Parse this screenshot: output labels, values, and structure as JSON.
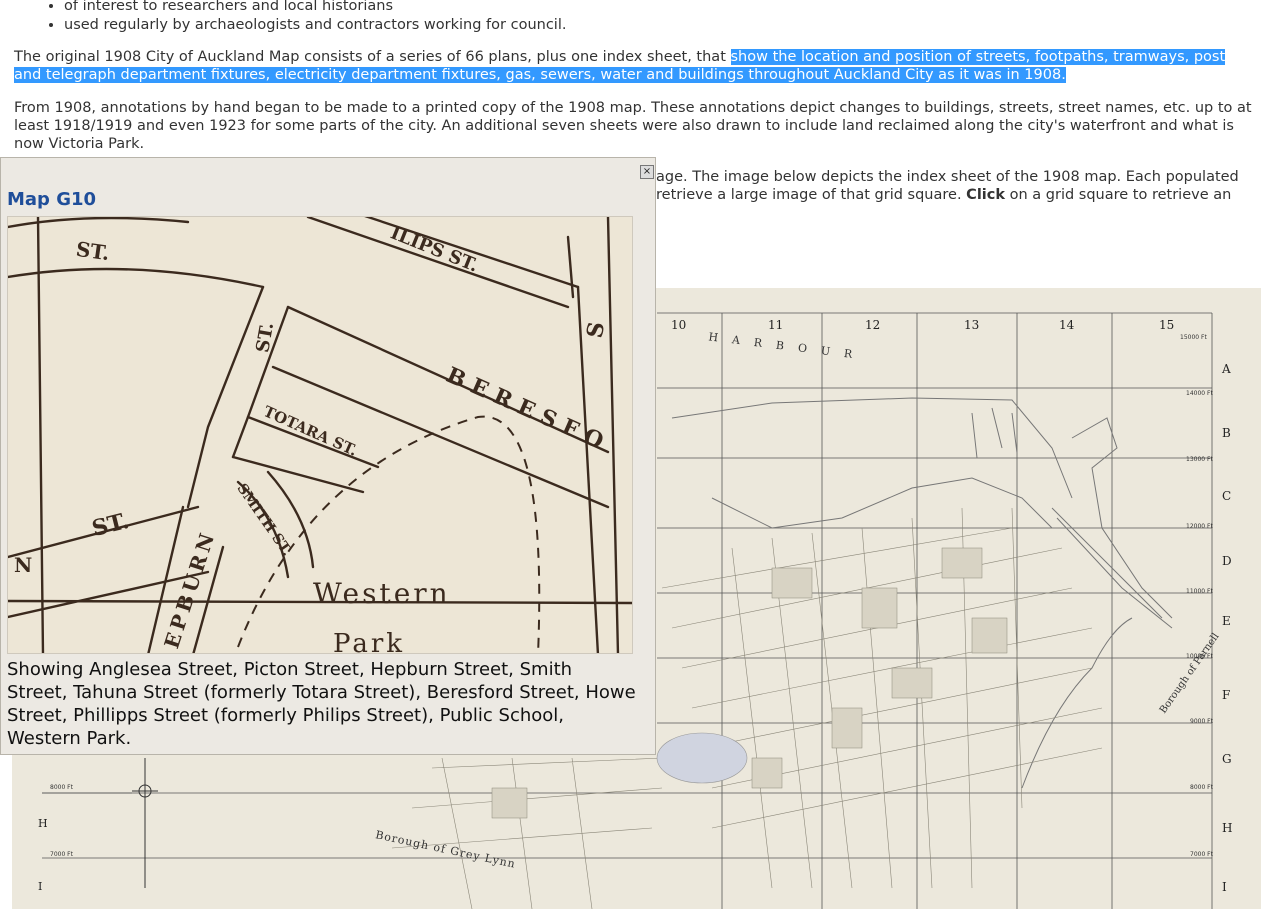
{
  "bullets": [
    "of interest to researchers and local historians",
    "used regularly by archaeologists and contractors working for council."
  ],
  "paragraphs": {
    "p1_plain": "The original 1908 City of Auckland Map consists of a series of 66 plans, plus one index sheet, that ",
    "p1_selected": "show the location and position of streets, footpaths, tramways, post and telegraph department fixtures, electricity department fixtures, gas, sewers, water and buildings throughout Auckland City as it was in 1908.",
    "p2": "From 1908, annotations by hand began to be made to a printed copy of the 1908 map. These annotations depict changes to buildings, streets, street names, etc. up to at least 1918/1919 and even 1923 for some parts of the city. An additional seven sheets were also drawn to include land reclaimed along the city's waterfront and what is now Victoria Park.",
    "p3_line1": "age. The image below depicts the index sheet of the 1908 map. Each populated",
    "p3_line2_pre": "retrieve a large image of that grid square. ",
    "p3_click": "Click",
    "p3_line2_post": " on a grid square to retrieve an"
  },
  "index_map": {
    "columns": [
      "10",
      "11",
      "12",
      "13",
      "14",
      "15"
    ],
    "rows": [
      "A",
      "B",
      "C",
      "D",
      "E",
      "F",
      "G",
      "H",
      "I"
    ],
    "left_rows": [
      "H",
      "I"
    ],
    "harbour_label": "HARBOUR",
    "borough_grey_lynn": "Borough of Grey Lynn",
    "borough_parnell": "Borough of Parnell",
    "ft_labels": [
      "15000 Ft",
      "14000 Ft",
      "13000 Ft",
      "12000 Ft",
      "11000 Ft",
      "10000 Ft",
      "9000 Ft",
      "8000 Ft",
      "7000 Ft"
    ],
    "left_ft_labels": [
      "8000 Ft",
      "7000 Ft"
    ]
  },
  "popup": {
    "close_label": "×",
    "title": "Map G10",
    "caption": "Showing Anglesea Street, Picton Street, Hepburn Street, Smith Street, Tahuna Street (formerly Totara Street), Beresford Street, Howe Street, Phillipps Street (formerly Philips Street), Public School, Western Park.",
    "image_labels": {
      "st_top": "ST.",
      "philips": "ILIPS ST.",
      "beresford": "BERESFO",
      "totara": "TOTARA ST.",
      "smith": "SMITH ST.",
      "st_left": "ST.",
      "n": "N",
      "hepburn": "EPBURN",
      "western": "Western",
      "park": "Park",
      "st_vertical": "ST.",
      "s_right": "S"
    }
  }
}
